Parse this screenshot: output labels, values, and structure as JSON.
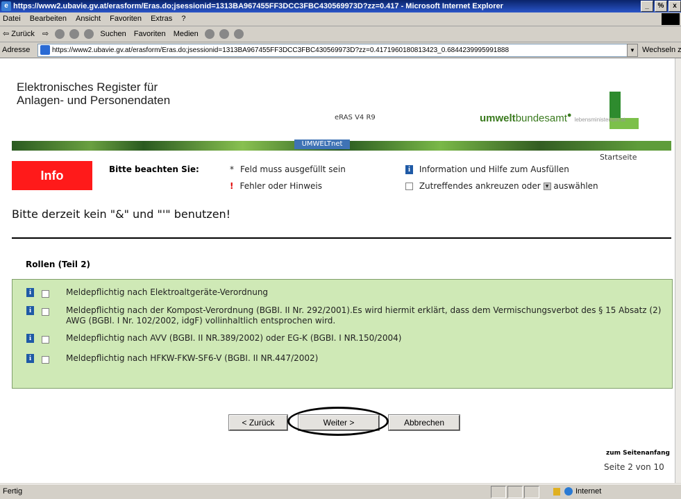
{
  "window": {
    "title": "https://www2.ubavie.gv.at/erasform/Eras.do;jsessionid=1313BA967455FF3DCC3FBC430569973D?zz=0.417 - Microsoft Internet Explorer",
    "controls": [
      "_",
      "%",
      "x"
    ]
  },
  "menu": [
    "Datei",
    "Bearbeiten",
    "Ansicht",
    "Favoriten",
    "Extras",
    "?"
  ],
  "toolbar": {
    "back": "⇦ Zurück",
    "forward": "⇨",
    "search": "Suchen",
    "favorites": "Favoriten",
    "media": "Medien"
  },
  "address": {
    "label": "Adresse",
    "url": "https://www2.ubavie.gv.at/erasform/Eras.do;jsessionid=1313BA967455FF3DCC3FBC430569973D?zz=0.4171960180813423_0.6844239995991888",
    "go": "Wechseln zu"
  },
  "header": {
    "title_line1": "Elektronisches Register für",
    "title_line2": "Anlagen- und Personendaten",
    "version": "eRAS V4 R9",
    "brand_bold": "umwelt",
    "brand_rest": "bundesamt",
    "brand_sub": "lebensministerium.at",
    "umweltnet": "UMWELTnet",
    "startseite": "Startseite"
  },
  "info": {
    "label": "Info",
    "title": "Bitte beachten Sie:",
    "required": "Feld muss ausgefüllt sein",
    "error": "Fehler oder Hinweis",
    "help": "Information und Hilfe zum Ausfüllen",
    "check": "Zutreffendes ankreuzen oder",
    "select": "auswählen"
  },
  "warning": "Bitte derzeit kein \"&\" und \"'\" benutzen!",
  "section": "Rollen (Teil 2)",
  "roles": [
    "Meldepflichtig nach Elektroaltgeräte-Verordnung",
    "Meldepflichtig nach der Kompost-Verordnung (BGBI. II Nr. 292/2001).Es wird hiermit erklärt, dass dem Vermischungsverbot des § 15 Absatz (2) AWG (BGBl. I Nr. 102/2002, idgF) vollinhaltlich entsprochen wird.",
    "Meldepflichtig nach AVV (BGBI. II NR.389/2002) oder EG-K (BGBI. I NR.150/2004)",
    "Meldepflichtig nach HFKW-FKW-SF6-V (BGBI. II NR.447/2002)"
  ],
  "buttons": {
    "back": "< Zurück",
    "next": "Weiter >",
    "cancel": "Abbrechen"
  },
  "footer": {
    "top_link": "zum Seitenanfang",
    "page": "Seite 2 von 10"
  },
  "status": {
    "text": "Fertig",
    "zone": "Internet"
  }
}
